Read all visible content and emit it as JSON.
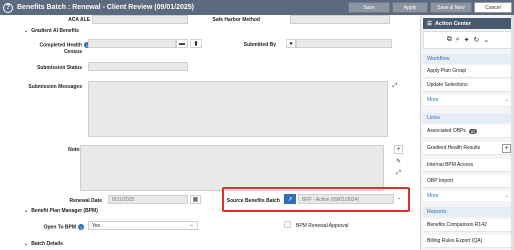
{
  "window": {
    "title": "Benefits Batch : Renewal - Client Review (09/01/2025)",
    "help_icon": "?",
    "buttons": {
      "save": "Save",
      "apply": "Apply",
      "save_new": "Save & New",
      "cancel": "Cancel"
    }
  },
  "form": {
    "aca_ale_label": "ACA ALE",
    "safe_harbor_label": "Safe Harbor Method",
    "gradient_section": "Gradient AI Benefits",
    "completed_health_label": "Completed Health",
    "census_label": "Census",
    "submitted_by_label": "Submitted By",
    "submission_status_label": "Submission Status",
    "submission_messages_label": "Submission Messages",
    "notes_label": "Notes",
    "renewal_date_label": "Renewal Date",
    "renewal_date_value": "8/31/2025",
    "source_batch_label": "Source Benefits Batch",
    "source_batch_value": "BFP - Active (09/01/2024)",
    "bpm_section": "Benefit Plan Manager (BPM)",
    "open_to_bpm_label": "Open To BPM",
    "open_to_bpm_value": "Yes",
    "bpm_renewal_label": "BPM Renewal Approval",
    "batch_details_section": "Batch Details"
  },
  "action_center": {
    "title": "Action Center",
    "workflow": {
      "label": "Workflow",
      "items": [
        "Apply Plan Group",
        "Update Selections"
      ],
      "more": "More"
    },
    "links": {
      "label": "Links",
      "items": [
        "Associated OBPs",
        "Gradient Health Results",
        "Internal BPM Access",
        "OBP Import"
      ],
      "badge": "83",
      "more": "More"
    },
    "reports": {
      "label": "Reports",
      "items": [
        "Benefits Comparison R142",
        "Billing Rules Export (QA)"
      ]
    }
  }
}
